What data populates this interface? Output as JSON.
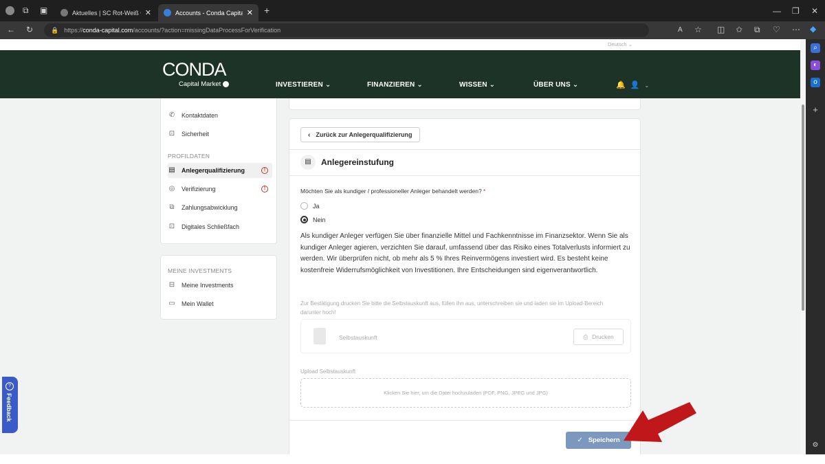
{
  "browser": {
    "tabs": [
      {
        "label": "Aktuelles | SC Rot-Weiß Oberhausen",
        "active": false
      },
      {
        "label": "Accounts - Conda Capital Market",
        "active": true
      }
    ],
    "url_prefix": "https://",
    "url_host": "conda-capital.com",
    "url_path": "/accounts/?action=missingDataProcessForVerification"
  },
  "site": {
    "language": "Deutsch ⌄",
    "logo_main": "CONDA",
    "logo_sub": "Capital Market",
    "nav": [
      "INVESTIEREN ⌄",
      "FINANZIEREN ⌄",
      "WISSEN ⌄",
      "ÜBER UNS ⌄"
    ]
  },
  "sidebar": {
    "top_items": [
      {
        "label": "Kontaktdaten",
        "icon": "phone-icon",
        "glyph": "✆"
      },
      {
        "label": "Sicherheit",
        "icon": "lock-icon",
        "glyph": "🔒"
      }
    ],
    "profile_section": "PROFILDATEN",
    "profile_items": [
      {
        "label": "Anlegerqualifizierung",
        "icon": "document-icon",
        "glyph": "▤",
        "active": true,
        "warning": true
      },
      {
        "label": "Verifizierung",
        "icon": "check-circle-icon",
        "glyph": "✓",
        "active": false,
        "warning": true
      },
      {
        "label": "Zahlungsabwicklung",
        "icon": "payment-icon",
        "glyph": "▭",
        "active": false,
        "warning": false
      },
      {
        "label": "Digitales Schließfach",
        "icon": "lock-icon",
        "glyph": "🔒",
        "active": false,
        "warning": false
      }
    ],
    "investments_section": "MEINE INVESTMENTS",
    "investment_items": [
      {
        "label": "Meine Investments",
        "icon": "folder-icon",
        "glyph": "▱"
      },
      {
        "label": "Mein Wallet",
        "icon": "wallet-icon",
        "glyph": "▭"
      }
    ]
  },
  "form": {
    "back_label": "Zurück zur Anlegerqualifizierung",
    "title": "Anlegereinstufung",
    "question": "Möchten Sie als kundiger / professioneller Anleger behandelt werden?",
    "required_mark": "*",
    "options": [
      {
        "label": "Ja",
        "checked": false
      },
      {
        "label": "Nein",
        "checked": true
      }
    ],
    "info_text": "Als kundiger Anleger verfügen Sie über finanzielle Mittel und Fachkenntnisse im Finanzsektor. Wenn Sie als kundiger Anleger agieren, verzichten Sie darauf, umfassend über das Risiko eines Totalverlusts informiert zu werden. Wir überprüfen nicht, ob mehr als 5 % Ihres Reinvermögens investiert wird. Es besteht keine kostenfreie Widerrufsmöglichkeit von Investitionen. Ihre Entscheidungen sind eigenverantwortlich.",
    "hint": "Zur Bestätigung drucken Sie bitte die Selbstauskunft aus, füllen ihn aus, unterschreiben sie und laden sie im Upload-Bereich darunter hoch!",
    "file_name": "Selbstauskunft",
    "print_label": "Drucken",
    "upload_label": "Upload Selbstauskunft",
    "dropzone_text": "Klicken Sie hier, um die Datei hochzuladen (PDF, PNG, JPEG und JPG)",
    "save_label": "Speichern"
  },
  "feedback": {
    "label": "Feedback"
  },
  "colors": {
    "header": "#1d3328",
    "save_button": "#7d98be",
    "arrow": "#c0171b",
    "warning": "#c0392b",
    "feedback": "#3a5bc7"
  }
}
